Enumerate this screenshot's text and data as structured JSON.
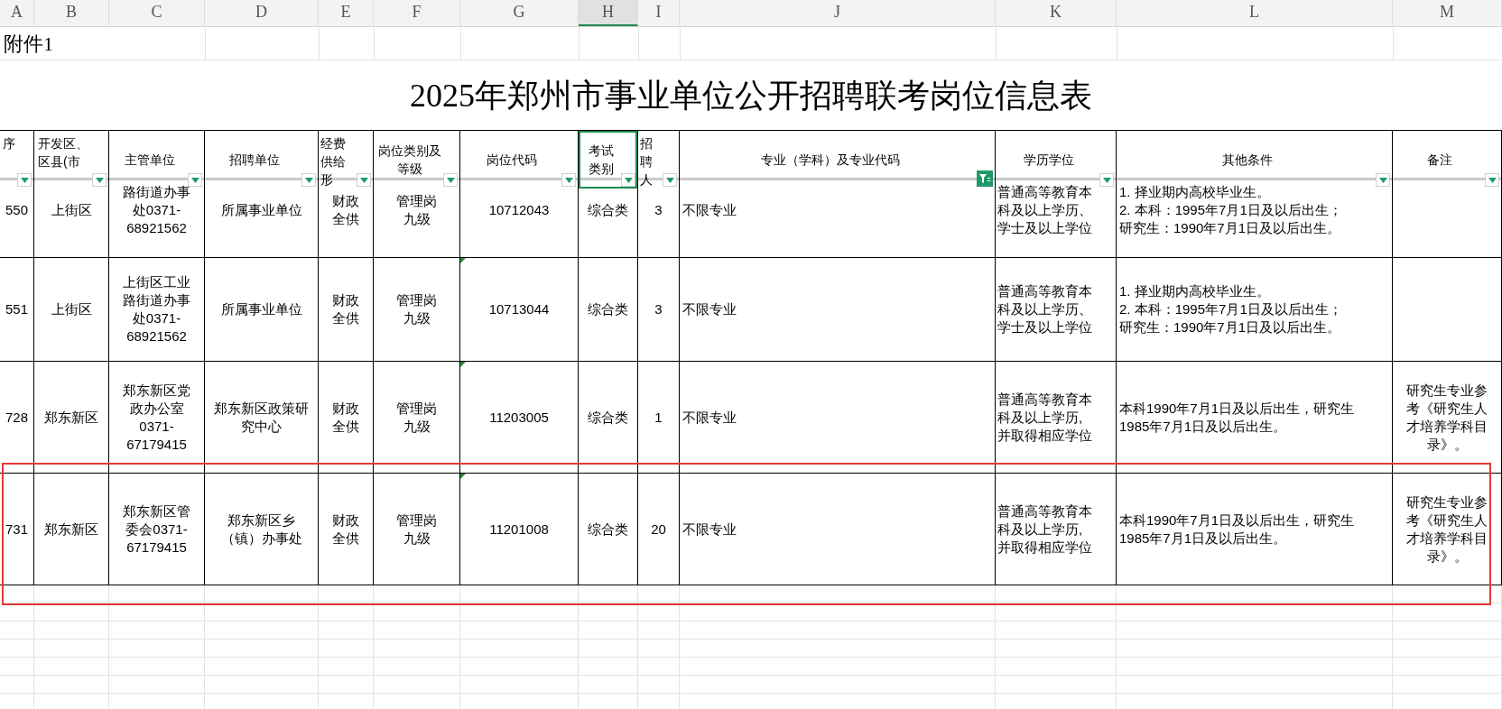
{
  "column_letters": [
    {
      "label": "A",
      "selected": false
    },
    {
      "label": "B",
      "selected": false
    },
    {
      "label": "C",
      "selected": false
    },
    {
      "label": "D",
      "selected": false
    },
    {
      "label": "E",
      "selected": false
    },
    {
      "label": "F",
      "selected": false
    },
    {
      "label": "G",
      "selected": false
    },
    {
      "label": "H",
      "selected": true
    },
    {
      "label": "I",
      "selected": false
    },
    {
      "label": "J",
      "selected": false
    },
    {
      "label": "K",
      "selected": false
    },
    {
      "label": "L",
      "selected": false
    },
    {
      "label": "M",
      "selected": false
    }
  ],
  "attachment_label": "附件1",
  "title": "2025年郑州市事业单位公开招聘联考岗位信息表",
  "headers": [
    {
      "label": "序",
      "filter_active": false,
      "selected": false
    },
    {
      "label": "开发区、区县(市",
      "filter_active": false,
      "selected": false
    },
    {
      "label": "主管单位",
      "filter_active": false,
      "selected": false
    },
    {
      "label": "招聘单位",
      "filter_active": false,
      "selected": false
    },
    {
      "label": "经费供给形",
      "filter_active": false,
      "selected": false
    },
    {
      "label": "岗位类别及等级",
      "filter_active": false,
      "selected": false
    },
    {
      "label": "岗位代码",
      "filter_active": false,
      "selected": false
    },
    {
      "label": "考试类别",
      "filter_active": false,
      "selected": true
    },
    {
      "label": "招聘人",
      "filter_active": false,
      "selected": false
    },
    {
      "label": "专业（学科）及专业代码",
      "filter_active": true,
      "selected": false
    },
    {
      "label": "学历学位",
      "filter_active": false,
      "selected": false
    },
    {
      "label": "其他条件",
      "filter_active": false,
      "selected": false
    },
    {
      "label": "备注",
      "filter_active": false,
      "selected": false
    }
  ],
  "rows": [
    {
      "no": "550",
      "district": "上街区",
      "supervisor": "路街道办事处0371-68921562",
      "unit": "所属事业单位",
      "funding": "财政全供",
      "post": "管理岗九级",
      "code": "10712043",
      "code_flag": false,
      "exam": "综合类",
      "count": "3",
      "major": "不限专业",
      "education": "普通高等教育本科及以上学历、学士及以上学位",
      "conditions": [
        "1. 择业期内高校毕业生。",
        "2. 本科：1995年7月1日及以后出生；",
        "研究生：1990年7月1日及以后出生。"
      ],
      "highlight": false
    },
    {
      "no": "551",
      "district": "上街区",
      "supervisor": "上街区工业路街道办事处0371-68921562",
      "unit": "所属事业单位",
      "funding": "财政全供",
      "post": "管理岗九级",
      "code": "10713044",
      "code_flag": true,
      "exam": "综合类",
      "count": "3",
      "major": "不限专业",
      "education": "普通高等教育本科及以上学历、学士及以上学位",
      "conditions": [
        "1. 择业期内高校毕业生。",
        "2. 本科：1995年7月1日及以后出生；",
        "研究生：1990年7月1日及以后出生。"
      ],
      "highlight": false
    },
    {
      "no": "728",
      "district": "郑东新区",
      "supervisor": "郑东新区党政办公室0371-67179415",
      "unit": "郑东新区政策研究中心",
      "funding": "财政全供",
      "post": "管理岗九级",
      "code": "11203005",
      "code_flag": true,
      "exam": "综合类",
      "count": "1",
      "major": "不限专业",
      "education": "普通高等教育本科及以上学历,并取得相应学位",
      "conditions": [
        "本科1990年7月1日及以后出生，研究生1985年7月1日及以后出生。"
      ],
      "remarks": "研究生专业参考《研究生人才培养学科目录》。",
      "highlight": false
    },
    {
      "no": "731",
      "district": "郑东新区",
      "supervisor": "郑东新区管委会0371-67179415",
      "unit": "郑东新区乡（镇）办事处",
      "funding": "财政全供",
      "post": "管理岗九级",
      "code": "11201008",
      "code_flag": true,
      "exam": "综合类",
      "count": "20",
      "major": "不限专业",
      "education": "普通高等教育本科及以上学历,并取得相应学位",
      "conditions": [
        "本科1990年7月1日及以后出生，研究生1985年7月1日及以后出生。"
      ],
      "remarks": "研究生专业参考《研究生人才培养学科目录》。",
      "highlight": true
    }
  ]
}
